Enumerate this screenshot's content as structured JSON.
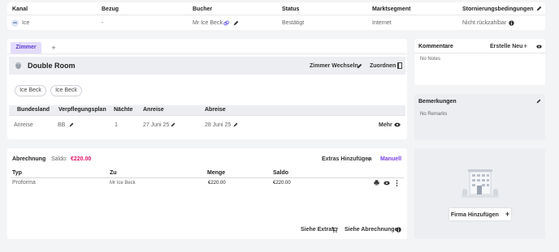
{
  "booking_table": {
    "headers": [
      "Kanal",
      "Bezug",
      "Bucher",
      "Status",
      "Marktsegment",
      "Stornierungsbedingungen"
    ],
    "row": {
      "kanal": "Ice",
      "kanal_logo": "ICE",
      "bezug": "-",
      "bucher": "Mr Ice Beck",
      "status": "Bestätigt",
      "marktsegment": "Internet",
      "storno": "Nicht rückzahlbar"
    }
  },
  "room": {
    "tabs": [
      "Zimmer",
      "+"
    ],
    "title": "Double Room",
    "actions": {
      "change": "Zimmer Wechseln",
      "assign": "Zuordnen"
    },
    "guests": [
      "Ice Beck",
      "Ice Beck"
    ],
    "columns": [
      "Bundesland",
      "Verpflegungsplan",
      "Nächte",
      "Anreise",
      "Abreise"
    ],
    "row": {
      "bundesland": "Anreise",
      "plan": "BB",
      "naechte": "1",
      "anreise": "27 Juni 25",
      "abreise": "28 Juni 25",
      "more": "Mehr"
    }
  },
  "billing": {
    "title": "Abrechnung",
    "saldo_label": "Saldo:",
    "saldo_value": "€220.00",
    "extras": "Extras Hinzufügen",
    "manual": "Manuell",
    "columns": [
      "Typ",
      "Zu",
      "Menge",
      "Saldo"
    ],
    "row": {
      "typ": "Proforma",
      "zu": "Mr Ice Beck",
      "menge": "€220.00",
      "saldo": "€220.00"
    },
    "footer": {
      "extras": "Siehe Extras",
      "abrechnungen": "Siehe Abrechnungen"
    }
  },
  "comments": {
    "title": "Kommentare",
    "create": "Erstelle Neu",
    "empty": "No Notes"
  },
  "remarks": {
    "title": "Bemerkungen",
    "empty": "No Remarks"
  },
  "company": {
    "button": "Firma Hinzufügen"
  },
  "colors": {
    "accent": "#e0156b",
    "link": "#7b3fe4",
    "tab_active": "#e4dcfb"
  },
  "icons": [
    "pencil-icon",
    "eye-icon",
    "plus-icon",
    "info-icon",
    "printer-icon",
    "more-vertical-icon",
    "cart-icon",
    "bed-icon",
    "building-icon",
    "link-icon"
  ]
}
